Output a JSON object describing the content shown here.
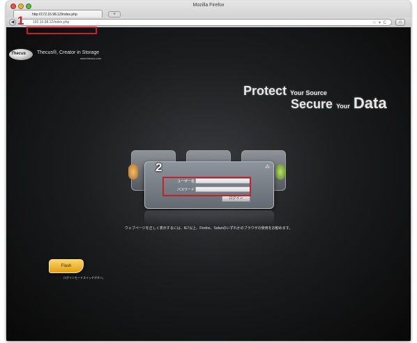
{
  "window": {
    "title": "Mozilla Firefox"
  },
  "tab": {
    "title": "http://172.16.98.12/index.php",
    "new_tab_symbol": "+"
  },
  "navbar": {
    "back_symbol": "◀",
    "url": "192.16.98.12/index.php",
    "tools": "☆ ▾ C",
    "home_symbol": "⌂"
  },
  "brand": {
    "logo_text": "Thecus",
    "tagline": "Thecus®, Creator in Storage",
    "url": "www.thecus.com"
  },
  "hero": {
    "line1_big": "Protect",
    "line1_small": "Your Source",
    "line2_big1": "Secure",
    "line2_small": "Your",
    "line2_big2": "Data"
  },
  "login": {
    "network_icon": "network-icon",
    "username_label": "ユーザー名",
    "password_label": "パスワード",
    "username_value": "",
    "password_value": "",
    "submit_label": "ログイン"
  },
  "notice": "ウェブページを正しく表示するには、IE7以上、Firefox、Safariのいずれかのブラウザの使用をお勧めます。",
  "flash": {
    "label": "Flash",
    "caption": "ログインモードスイッチボタン。"
  },
  "callouts": {
    "first": "1",
    "second": "2"
  },
  "colors": {
    "highlight": "#c8202a",
    "flash_button": "#f0b830",
    "background": "#0c0c0c"
  }
}
